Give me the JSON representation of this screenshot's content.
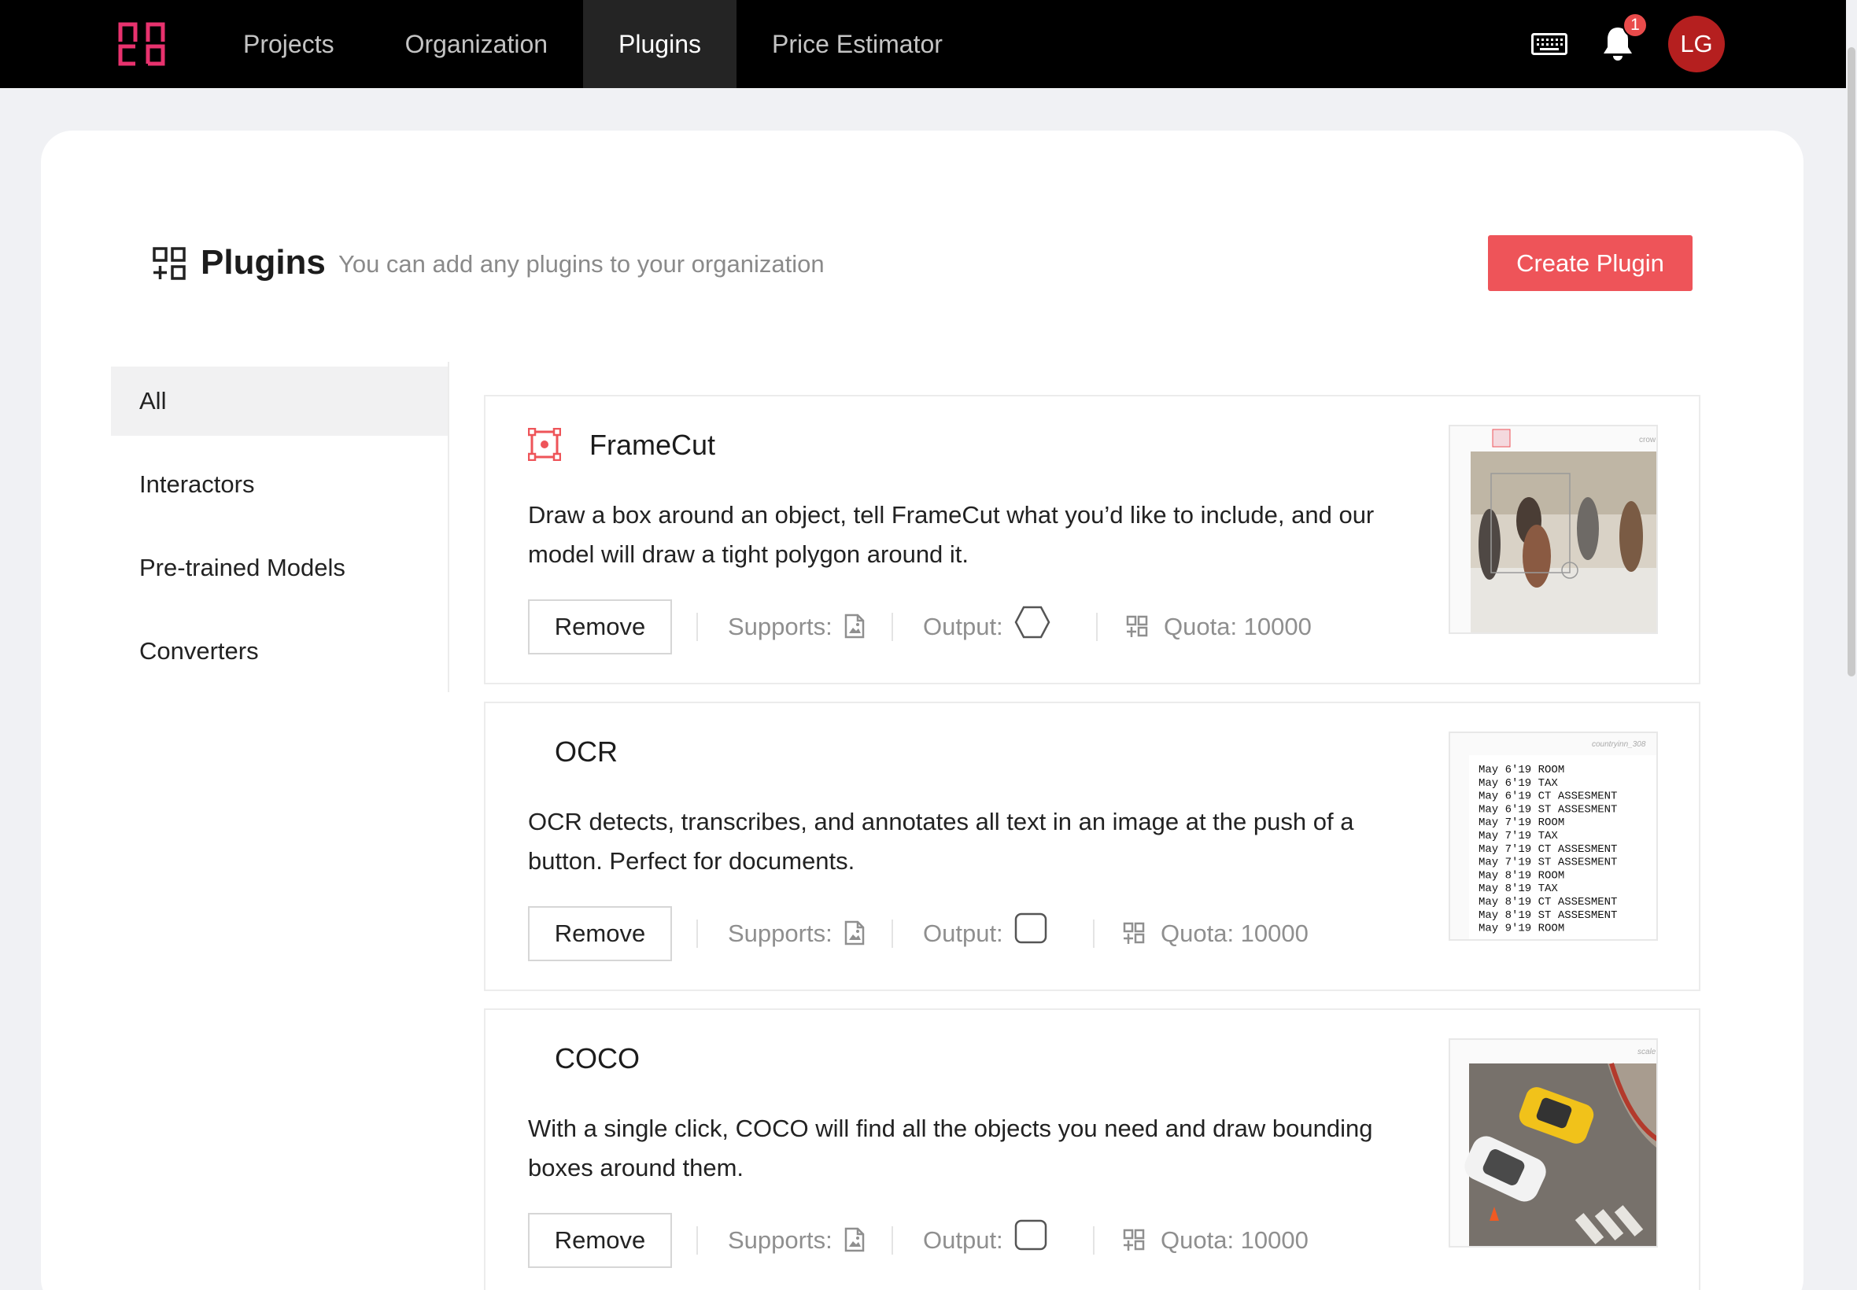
{
  "nav": {
    "items": [
      "Projects",
      "Organization",
      "Plugins",
      "Price Estimator"
    ],
    "active": "Plugins",
    "notification_count": "1",
    "avatar_initials": "LG"
  },
  "header": {
    "title": "Plugins",
    "subtitle": "You can add any plugins to your organization",
    "create_label": "Create Plugin"
  },
  "sidebar": {
    "items": [
      {
        "label": "All"
      },
      {
        "label": "Interactors"
      },
      {
        "label": "Pre-trained Models"
      },
      {
        "label": "Converters"
      }
    ],
    "active": "All"
  },
  "plugins": [
    {
      "name": "FrameCut",
      "description": "Draw a box around an object, tell FrameCut what you’d like to include, and our model will draw a tight polygon around it.",
      "remove_label": "Remove",
      "supports_label": "Supports:",
      "output_label": "Output:",
      "output_icon": "hexagon-icon",
      "quota_label": "Quota: 10000",
      "thumb_caption": "crow"
    },
    {
      "name": "OCR",
      "description": "OCR detects, transcribes, and annotates all text in an image at the push of a button. Perfect for documents.",
      "remove_label": "Remove",
      "supports_label": "Supports:",
      "output_label": "Output:",
      "output_icon": "rounded-square-icon",
      "quota_label": "Quota: 10000",
      "thumb_caption": "countryinn_308",
      "thumb_lines": [
        "May 6'19 ROOM",
        "May 6'19 TAX",
        "May 6'19 CT ASSESMENT",
        "May 6'19 ST ASSESMENT",
        "May 7'19 ROOM",
        "May 7'19 TAX",
        "May 7'19 CT ASSESMENT",
        "May 7'19 ST ASSESMENT",
        "May 8'19 ROOM",
        "May 8'19 TAX",
        "May 8'19 CT ASSESMENT",
        "May 8'19 ST ASSESMENT",
        "May 9'19 ROOM"
      ]
    },
    {
      "name": "COCO",
      "description": "With a single click, COCO will find all the objects you need and draw bounding boxes around them.",
      "remove_label": "Remove",
      "supports_label": "Supports:",
      "output_label": "Output:",
      "output_icon": "rounded-square-icon",
      "quota_label": "Quota: 10000",
      "thumb_caption": "scale"
    }
  ],
  "colors": {
    "accent": "#ee5459",
    "topbar": "#000000",
    "avatar": "#b51f1f"
  }
}
